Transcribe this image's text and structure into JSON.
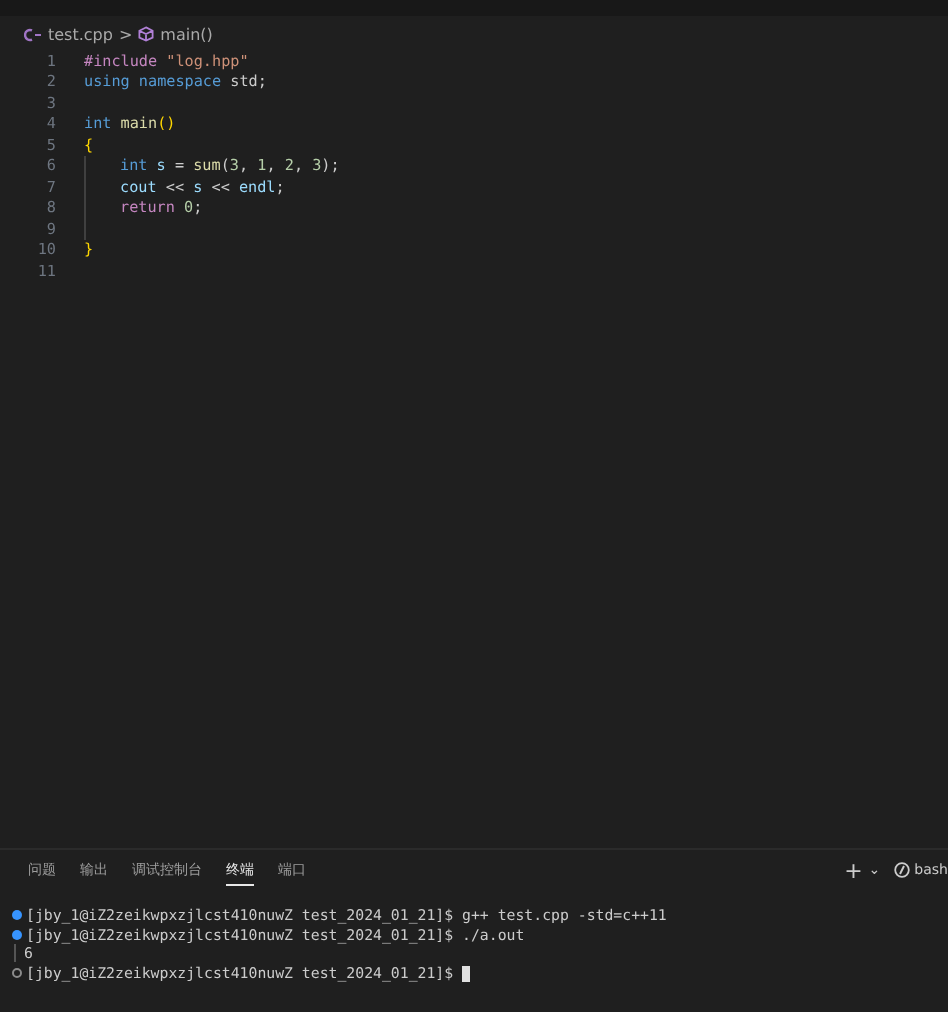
{
  "breadcrumb": {
    "file": "test.cpp",
    "separator": ">",
    "symbol": "main()"
  },
  "code_lines": [
    {
      "number": "1",
      "tokens": [
        {
          "kind": "directive",
          "text": "#include"
        },
        {
          "kind": "string",
          "text": " \"log.hpp\""
        }
      ]
    },
    {
      "number": "2",
      "tokens": [
        {
          "kind": "keyword",
          "text": "using namespace"
        },
        {
          "kind": "plain",
          "text": " std;"
        }
      ]
    },
    {
      "number": "3"
    },
    {
      "number": "4",
      "tokens": [
        {
          "kind": "keyword",
          "text": "int"
        },
        {
          "kind": "function",
          "text": " main"
        },
        {
          "kind": "bracket",
          "text": "()"
        }
      ]
    },
    {
      "number": "5",
      "tokens": [
        {
          "kind": "bracket",
          "text": "{"
        }
      ]
    },
    {
      "number": "6",
      "indented": true,
      "tokens": [
        {
          "kind": "keyword",
          "text": "int"
        },
        {
          "kind": "variable",
          "text": " s"
        },
        {
          "kind": "plain",
          "text": " = "
        },
        {
          "kind": "function",
          "text": "sum"
        },
        {
          "kind": "plain",
          "text": "("
        },
        {
          "kind": "number",
          "text": "3"
        },
        {
          "kind": "plain",
          "text": ", "
        },
        {
          "kind": "number",
          "text": "1"
        },
        {
          "kind": "plain",
          "text": ", "
        },
        {
          "kind": "number",
          "text": "2"
        },
        {
          "kind": "plain",
          "text": ", "
        },
        {
          "kind": "number",
          "text": "3"
        },
        {
          "kind": "plain",
          "text": ");"
        }
      ]
    },
    {
      "number": "7",
      "indented": true,
      "tokens": [
        {
          "kind": "variable",
          "text": "cout"
        },
        {
          "kind": "plain",
          "text": " << "
        },
        {
          "kind": "variable",
          "text": "s"
        },
        {
          "kind": "plain",
          "text": " << "
        },
        {
          "kind": "variable",
          "text": "endl"
        },
        {
          "kind": "plain",
          "text": ";"
        }
      ]
    },
    {
      "number": "8",
      "indented": true,
      "tokens": [
        {
          "kind": "control",
          "text": "return"
        },
        {
          "kind": "number",
          "text": " 0"
        },
        {
          "kind": "plain",
          "text": ";"
        }
      ]
    },
    {
      "number": "9",
      "indented": true
    },
    {
      "number": "10",
      "tokens": [
        {
          "kind": "bracket",
          "text": "}"
        }
      ]
    },
    {
      "number": "11"
    }
  ],
  "panel": {
    "tabs": [
      {
        "label": "问题",
        "selected": false
      },
      {
        "label": "输出",
        "selected": false
      },
      {
        "label": "调试控制台",
        "selected": false
      },
      {
        "label": "终端",
        "selected": true
      },
      {
        "label": "端口",
        "selected": false
      }
    ],
    "new_terminal": "+",
    "dropdown": "⌄",
    "shell": "bash",
    "terminal_lines": [
      {
        "kind": "success",
        "text": "[jby_1@iZ2zeikwpxzjlcst410nuwZ test_2024_01_21]$ g++ test.cpp -std=c++11"
      },
      {
        "kind": "success",
        "text": "[jby_1@iZ2zeikwpxzjlcst410nuwZ test_2024_01_21]$ ./a.out"
      },
      {
        "kind": "output",
        "text": "6"
      },
      {
        "kind": "pending",
        "text": "[jby_1@iZ2zeikwpxzjlcst410nuwZ test_2024_01_21]$",
        "cursor": true
      }
    ]
  }
}
